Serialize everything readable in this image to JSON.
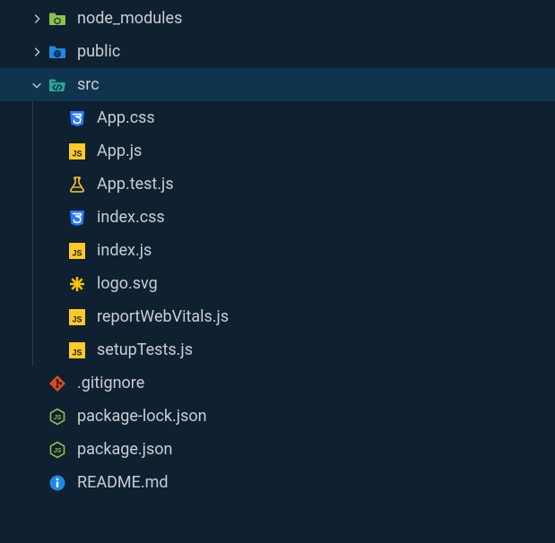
{
  "tree": [
    {
      "name": "node_modules",
      "icon": "folder-node",
      "depth": 0,
      "expanded": false,
      "hasChildren": true,
      "selected": false
    },
    {
      "name": "public",
      "icon": "folder-public",
      "depth": 0,
      "expanded": false,
      "hasChildren": true,
      "selected": false
    },
    {
      "name": "src",
      "icon": "folder-src-open",
      "depth": 0,
      "expanded": true,
      "hasChildren": true,
      "selected": true
    },
    {
      "name": "App.css",
      "icon": "css",
      "depth": 1,
      "hasChildren": false,
      "selected": false
    },
    {
      "name": "App.js",
      "icon": "js",
      "depth": 1,
      "hasChildren": false,
      "selected": false
    },
    {
      "name": "App.test.js",
      "icon": "test",
      "depth": 1,
      "hasChildren": false,
      "selected": false
    },
    {
      "name": "index.css",
      "icon": "css",
      "depth": 1,
      "hasChildren": false,
      "selected": false
    },
    {
      "name": "index.js",
      "icon": "js",
      "depth": 1,
      "hasChildren": false,
      "selected": false
    },
    {
      "name": "logo.svg",
      "icon": "svg",
      "depth": 1,
      "hasChildren": false,
      "selected": false
    },
    {
      "name": "reportWebVitals.js",
      "icon": "js",
      "depth": 1,
      "hasChildren": false,
      "selected": false
    },
    {
      "name": "setupTests.js",
      "icon": "js",
      "depth": 1,
      "hasChildren": false,
      "selected": false
    },
    {
      "name": ".gitignore",
      "icon": "git",
      "depth": 0,
      "hasChildren": false,
      "selected": false
    },
    {
      "name": "package-lock.json",
      "icon": "nodejs",
      "depth": 0,
      "hasChildren": false,
      "selected": false
    },
    {
      "name": "package.json",
      "icon": "nodejs",
      "depth": 0,
      "hasChildren": false,
      "selected": false
    },
    {
      "name": "README.md",
      "icon": "info",
      "depth": 0,
      "hasChildren": false,
      "selected": false
    }
  ],
  "icons": {
    "chevron-right": "<svg viewBox='0 0 16 16'><polyline points='6,3 11,8 6,13'/></svg>",
    "chevron-down": "<svg viewBox='0 0 16 16'><polyline points='3,6 8,11 13,6'/></svg>",
    "folder-node": "<svg viewBox='0 0 20 20'><path d='M1 5 L1 16 Q1 17 2 17 L18 17 Q19 17 19 16 L19 7 Q19 6 18 6 L9 6 L7.5 4 Q7 3.5 6.5 3.5 L2 3.5 Q1 3.5 1 5 Z' fill='#8bc34a'/><path d='M10 9 L13 10.7 L13 14 L10 15.7 L7 14 L7 10.7 Z' fill='none' stroke='#0f2031' stroke-width='1.1'/></svg>",
    "folder-public": "<svg viewBox='0 0 20 20'><path d='M1 5 L1 16 Q1 17 2 17 L18 17 Q19 17 19 16 L19 7 Q19 6 18 6 L9 6 L7.5 4 Q7 3.5 6.5 3.5 L2 3.5 Q1 3.5 1 5 Z' fill='#1e88e5'/><circle cx='10' cy='12' r='3.4' fill='none' stroke='#0f2031' stroke-width='1.1'/><path d='M6.6 12 L13.4 12 M10 8.6 L10 15.4 M10 8.6 Q12.2 10 12.2 12 Q12.2 14 10 15.4 M10 8.6 Q7.8 10 7.8 12 Q7.8 14 10 15.4' fill='none' stroke='#0f2031' stroke-width='0.9'/></svg>",
    "folder-src-open": "<svg viewBox='0 0 20 20'><path d='M1 5 L1 16 Q1 17 2 17 L17 17 L19 8 Q19.2 7 18 7 L4 7 L3 6 L9 6 L7.5 4 Q7 3.5 6.5 3.5 L2 3.5 Q1 3.5 1 5 Z' fill='#26a69a'/><path d='M7.5 10 L5 12.5 L7.5 15 M12.5 10 L15 12.5 L12.5 15 M11 9.5 L9 15.5' fill='none' stroke='#0f2031' stroke-width='1.3' stroke-linecap='round'/></svg>",
    "css": "<svg viewBox='0 0 20 20'><path d='M2 2 L18 2 L16.6 17 L10 19 L3.4 17 Z' fill='#2979ff'/><path d='M5.5 5.5 L14.5 5.5 L14 8 L8.5 8 L14 10.5 L13.3 14.5 L10 15.5 L6.7 14.5 L6.5 12.3' fill='none' stroke='#fff' stroke-width='1.5' stroke-linejoin='round' stroke-linecap='round'/></svg>",
    "js": "<svg viewBox='0 0 20 20'><rect x='1' y='1' width='18' height='18' fill='#ffca28'/><text x='10' y='15.5' font-family='Arial' font-size='9' font-weight='bold' fill='#1d1d1d' text-anchor='middle'>JS</text></svg>",
    "test": "<svg viewBox='0 0 20 20'><path d='M7 2 L13 2 L13 3.5 L12 3.5 L12 8 L17 16 Q17.6 17.6 16 18 L4 18 Q2.4 17.6 3 16 L8 8 L8 3.5 L7 3.5 Z' fill='none' stroke='#ffca28' stroke-width='1.6' stroke-linejoin='round'/><path d='M6 13 L14 13' stroke='#ffca28' stroke-width='1.4'/></svg>",
    "svg": "<svg viewBox='0 0 20 20'><g transform='translate(10,10)'><line x1='0' y1='-8' x2='0' y2='8' stroke='#ffc107' stroke-width='2.5'/><line x1='-8' y1='0' x2='8' y2='0' stroke='#ffc107' stroke-width='2.5'/><line x1='-5.7' y1='-5.7' x2='5.7' y2='5.7' stroke='#ffc107' stroke-width='2.5'/><line x1='-5.7' y1='5.7' x2='5.7' y2='-5.7' stroke='#ffc107' stroke-width='2.5'/><circle r='2' fill='#ffc107'/></g></svg>",
    "git": "<svg viewBox='0 0 20 20'><path d='M10 1 L19 10 L10 19 L1 10 Z' fill='#e64a19'/><circle cx='10' cy='6.5' r='1.5' fill='#0f2031'/><circle cx='10' cy='13.5' r='1.5' fill='#0f2031'/><circle cx='13.8' cy='10' r='1.5' fill='#0f2031'/><path d='M10 8 L10 12 M10 8 L13 10' stroke='#0f2031' stroke-width='1.4'/></svg>",
    "nodejs": "<svg viewBox='0 0 20 20'><path d='M10 1.5 L17.5 5.8 L17.5 14.2 L10 18.5 L2.5 14.2 L2.5 5.8 Z' fill='none' stroke='#8bc34a' stroke-width='1.6' stroke-linejoin='round'/><text x='10' y='13' font-family='Arial' font-size='7' font-weight='bold' fill='#8bc34a' text-anchor='middle' font-style='italic'>JS</text></svg>",
    "info": "<svg viewBox='0 0 20 20'><circle cx='10' cy='10' r='8.5' fill='#1e88e5'/><circle cx='10' cy='6' r='1.4' fill='#fff'/><rect x='8.8' y='8.5' width='2.4' height='6.5' rx='1' fill='#fff'/></svg>"
  }
}
